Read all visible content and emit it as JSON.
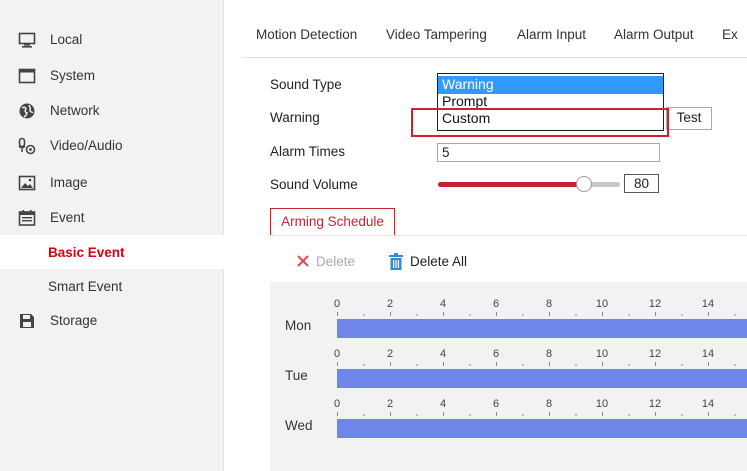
{
  "sidebar": {
    "items": [
      {
        "label": "Local",
        "icon": "monitor-icon"
      },
      {
        "label": "System",
        "icon": "window-icon"
      },
      {
        "label": "Network",
        "icon": "globe-icon"
      },
      {
        "label": "Video/Audio",
        "icon": "camera-mic-icon"
      },
      {
        "label": "Image",
        "icon": "image-icon"
      },
      {
        "label": "Event",
        "icon": "calendar-icon"
      },
      {
        "label": "Basic Event"
      },
      {
        "label": "Smart Event"
      },
      {
        "label": "Storage",
        "icon": "floppy-icon"
      }
    ],
    "active_item": "Basic Event",
    "active_color": "#d7000f"
  },
  "tabs": [
    "Motion Detection",
    "Video Tampering",
    "Alarm Input",
    "Alarm Output",
    "Ex"
  ],
  "form": {
    "sound_type_label": "Sound Type",
    "warning_label": "Warning",
    "alarm_times_label": "Alarm Times",
    "sound_volume_label": "Sound Volume",
    "sound_type_options": [
      "Warning",
      "Prompt",
      "Custom"
    ],
    "sound_type_selected": "Warning",
    "alarm_times_value": "5",
    "test_label": "Test",
    "sound_volume_value": "80",
    "sound_volume_max": 100,
    "slider_color": "#c8232c"
  },
  "schedule": {
    "tab_label": "Arming Schedule",
    "delete_label": "Delete",
    "delete_all_label": "Delete All",
    "hour_ticks": [
      "0",
      "2",
      "4",
      "6",
      "8",
      "10",
      "12",
      "14"
    ],
    "days": [
      "Mon",
      "Tue",
      "Wed"
    ],
    "bar_color": "#6d86e8"
  }
}
